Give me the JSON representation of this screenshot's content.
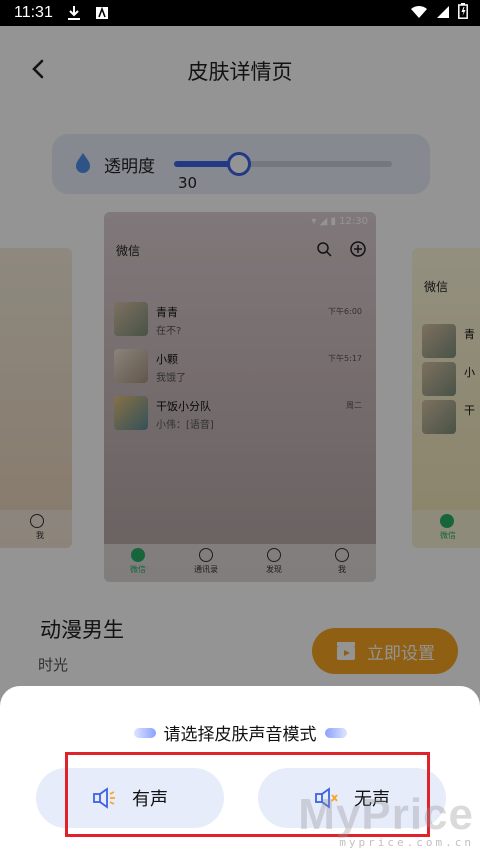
{
  "status_bar": {
    "time": "11:31"
  },
  "header": {
    "title": "皮肤详情页"
  },
  "opacity": {
    "label": "透明度",
    "value": "30",
    "fraction": 0.3
  },
  "preview": {
    "title": "微信",
    "chats": [
      {
        "name": "青青",
        "message": "在不?",
        "time": "下午6:00"
      },
      {
        "name": "小颗",
        "message": "我饿了",
        "time": "下午5:17"
      },
      {
        "name": "干饭小分队",
        "message": "小伟：[语音]",
        "time": "周二"
      }
    ],
    "tabs": [
      "微信",
      "通讯录",
      "发现",
      "我"
    ],
    "right_peek": {
      "title": "微信",
      "names": [
        "青",
        "小",
        "干"
      ],
      "tab": "微信"
    },
    "left_peek": {
      "tab": "我"
    }
  },
  "skin": {
    "name": "动漫男生",
    "subtitle": "时光",
    "apply_label": "立即设置"
  },
  "sheet": {
    "title": "请选择皮肤声音模式",
    "options": [
      {
        "label": "有声",
        "icon": "speaker-icon"
      },
      {
        "label": "无声",
        "icon": "speaker-mute-icon"
      }
    ]
  },
  "watermark": {
    "text": "MyPrice",
    "url": "myprice.com.cn"
  },
  "colors": {
    "accent": "#3b62e6",
    "apply": "#f6a623",
    "highlight": "#e0232a"
  }
}
